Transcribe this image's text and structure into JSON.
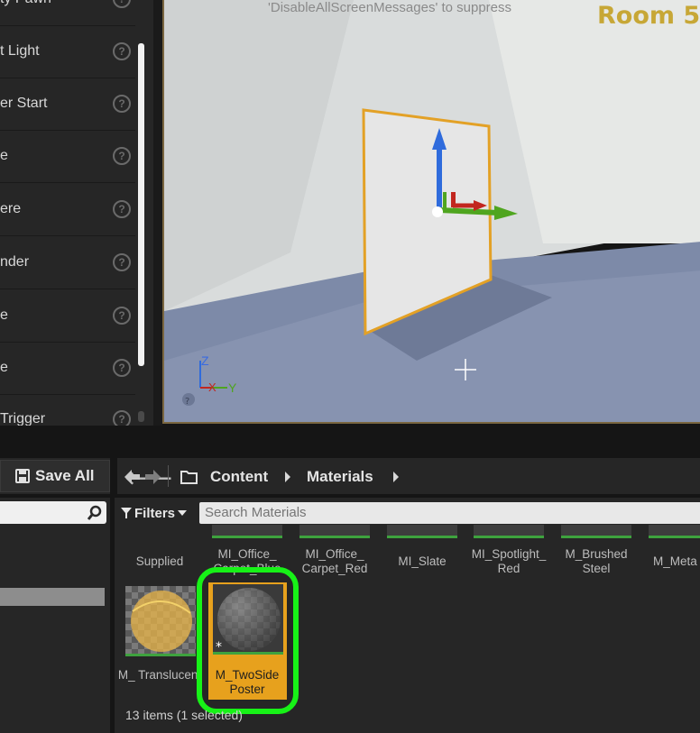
{
  "place_actors": {
    "items": [
      {
        "label": "ty Pawn"
      },
      {
        "label": "t Light"
      },
      {
        "label": "er Start"
      },
      {
        "label": "e"
      },
      {
        "label": "ere"
      },
      {
        "label": "nder"
      },
      {
        "label": "e"
      },
      {
        "label": "e"
      },
      {
        "label": "Trigger"
      }
    ],
    "help_glyph": "?"
  },
  "viewport": {
    "screen_message": "'DisableAllScreenMessages' to suppress",
    "room_label": "Room 5",
    "axis_z": "Z",
    "axis_x": "X",
    "axis_y": "Y",
    "colors": {
      "selection_outline": "#e3a126",
      "gizmo_z": "#2f6bdc",
      "gizmo_y": "#4fa51f",
      "gizmo_x": "#c2261f"
    }
  },
  "content_browser": {
    "save_all_label": "Save All",
    "breadcrumbs": [
      "Content",
      "Materials"
    ],
    "filters_label": "Filters",
    "search_placeholder": "Search Materials",
    "assets_row1": [
      {
        "label": "Supplied"
      },
      {
        "label": "MI_Office_ Carpet_Blue"
      },
      {
        "label": "MI_Office_ Carpet_Red"
      },
      {
        "label": "MI_Slate"
      },
      {
        "label": "MI_Spotlight_ Red"
      },
      {
        "label": "M_Brushed Steel"
      },
      {
        "label": "M_Meta"
      }
    ],
    "assets_row2": [
      {
        "label": "M_ Translucent"
      },
      {
        "label": "M_TwoSide Poster",
        "selected": true
      }
    ],
    "items_count": "13 items (1 selected)",
    "colors": {
      "selected_tile": "#e7a11d",
      "highlight_ring": "#17f217",
      "asset_underline": "#3ea23e"
    }
  }
}
